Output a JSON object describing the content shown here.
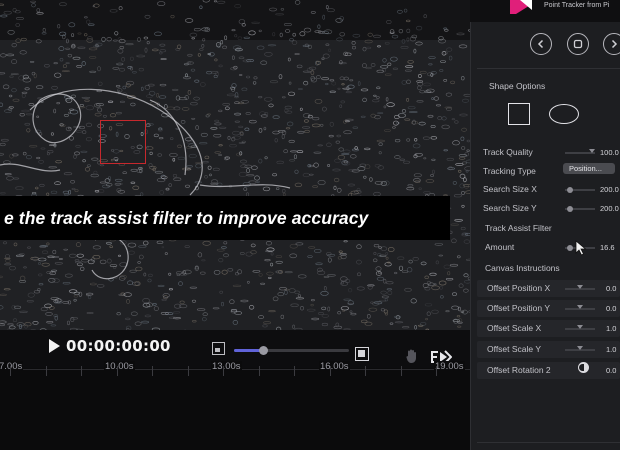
{
  "caption": {
    "text": "e the track assist filter to improve accuracy"
  },
  "transport": {
    "timecode": "00:00:00:00",
    "zoom_level": 0.25
  },
  "timeline": {
    "ticks": [
      {
        "label": "7.00s"
      },
      {
        "label": "10.00s"
      },
      {
        "label": "13.00s"
      },
      {
        "label": "16.00s"
      },
      {
        "label": "19.00s"
      }
    ]
  },
  "panel": {
    "plugin_name": "Point Tracker from Pi",
    "shape_options_title": "Shape Options",
    "properties": [
      {
        "label": "Track Quality",
        "value": "100.0",
        "control": "slider",
        "slider_level": 0.9
      },
      {
        "label": "Tracking Type",
        "value": "Position...",
        "control": "dropdown"
      },
      {
        "label": "Search Size X",
        "value": "200.0",
        "control": "slider",
        "slider_level": 0.15
      },
      {
        "label": "Search Size Y",
        "value": "200.0",
        "control": "slider",
        "slider_level": 0.15
      },
      {
        "label": "Track Assist Filter",
        "value": "",
        "control": "none"
      },
      {
        "label": "Amount",
        "value": "16.6",
        "control": "slider",
        "slider_level": 0.15
      },
      {
        "label": "Canvas Instructions",
        "value": "",
        "control": "none"
      },
      {
        "label": "Offset Position X",
        "value": "0.0",
        "control": "slider",
        "slider_level": 0.5
      },
      {
        "label": "Offset Position Y",
        "value": "0.0",
        "control": "slider",
        "slider_level": 0.5
      },
      {
        "label": "Offset Scale X",
        "value": "1.0",
        "control": "slider",
        "slider_level": 0.5
      },
      {
        "label": "Offset Scale Y",
        "value": "1.0",
        "control": "slider",
        "slider_level": 0.5
      },
      {
        "label": "Offset Rotation 2",
        "value": "0.0",
        "control": "knob"
      }
    ]
  },
  "colors": {
    "accent": "#6063d9",
    "track_box": "#c7282d",
    "panel_bg": "#1d1e21",
    "logo": "#e01f7a"
  },
  "icons": [
    "play-icon",
    "chevron-left-icon",
    "square-stop-icon",
    "chevron-right-icon",
    "hand-icon",
    "export-icon",
    "cursor-icon"
  ]
}
